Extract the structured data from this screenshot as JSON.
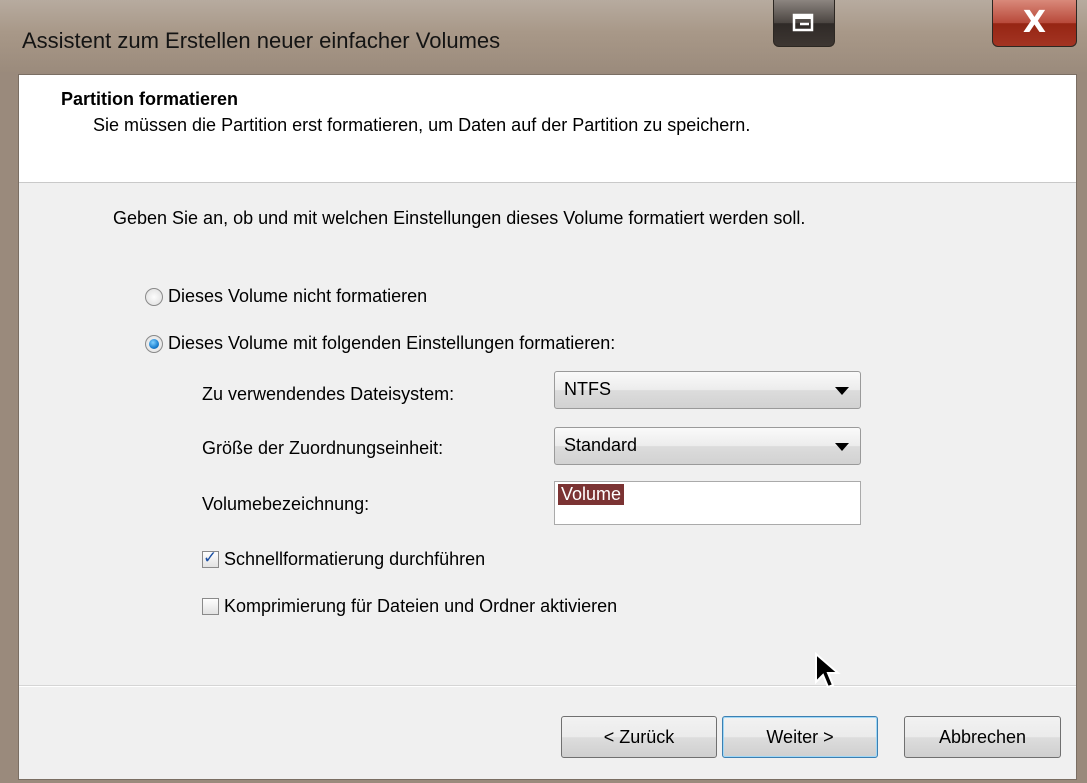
{
  "window": {
    "title": "Assistent zum Erstellen neuer einfacher Volumes",
    "close_label": "X"
  },
  "header": {
    "title": "Partition formatieren",
    "subtitle": "Sie müssen die Partition erst formatieren, um Daten auf der Partition zu speichern."
  },
  "body": {
    "instruction": "Geben Sie an, ob und mit welchen Einstellungen dieses Volume formatiert werden soll.",
    "radio_no_format": "Dieses Volume nicht formatieren",
    "radio_format": "Dieses Volume mit folgenden Einstellungen formatieren:",
    "selected_option": "Dieses Volume mit folgenden Einstellungen formatieren:",
    "filesystem_label": "Zu verwendendes Dateisystem:",
    "filesystem_value": "NTFS",
    "allocation_label": "Größe der Zuordnungseinheit:",
    "allocation_value": "Standard",
    "volume_label_label": "Volumebezeichnung:",
    "volume_label_value": "Volume",
    "quick_format_label": "Schnellformatierung durchführen",
    "quick_format_checked": true,
    "compression_label": "Komprimierung für Dateien und Ordner aktivieren",
    "compression_checked": false
  },
  "buttons": {
    "back": "< Zurück",
    "next": "Weiter >",
    "cancel": "Abbrechen"
  },
  "colors": {
    "title_bar": "#a89888",
    "close_button": "#b8493a",
    "selection": "#7b3333"
  },
  "icons": [
    "restore-icon",
    "close-icon",
    "mouse-cursor-icon",
    "checkmark-icon",
    "dropdown-arrow-icon"
  ]
}
